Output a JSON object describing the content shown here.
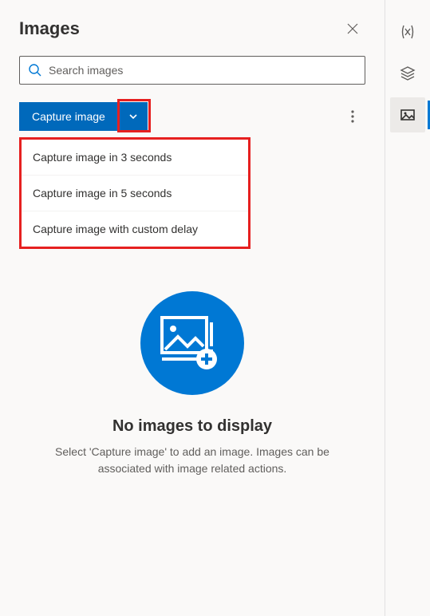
{
  "panel": {
    "title": "Images"
  },
  "search": {
    "placeholder": "Search images"
  },
  "toolbar": {
    "capture_label": "Capture image",
    "dropdown": [
      {
        "label": "Capture image in 3 seconds"
      },
      {
        "label": "Capture image in 5 seconds"
      },
      {
        "label": "Capture image with custom delay"
      }
    ]
  },
  "empty": {
    "title": "No images to display",
    "desc": "Select 'Capture image' to add an image. Images can be associated with image related actions."
  },
  "rail": {
    "items": [
      {
        "name": "variables-icon"
      },
      {
        "name": "layers-icon"
      },
      {
        "name": "images-icon"
      }
    ],
    "active_index": 2
  },
  "colors": {
    "primary": "#0069bb",
    "highlight": "#e62020"
  }
}
